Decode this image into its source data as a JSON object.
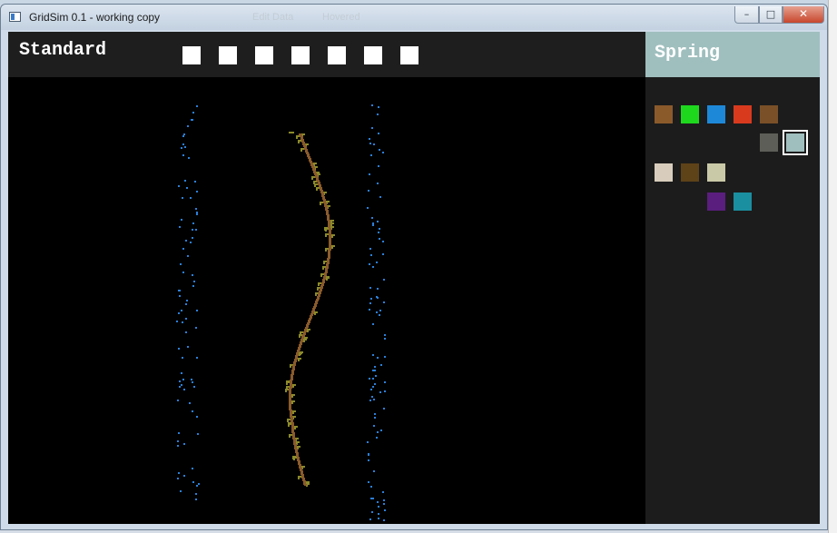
{
  "window": {
    "title": "GridSim 0.1 - working copy",
    "ghost_texts": [
      "Edit Data",
      "Hovered"
    ],
    "minimize_glyph": "–",
    "maximize_glyph": "□",
    "close_glyph": "✕"
  },
  "toolbar": {
    "mode_label": "Standard",
    "mode_buttons": 7,
    "mode_button_color": "#ffffff"
  },
  "panel": {
    "title": "Spring",
    "header_color": "#9fbfbe",
    "swatches": [
      {
        "color": "#8a5a2b",
        "selected": false
      },
      {
        "color": "#1ed81e",
        "selected": false
      },
      {
        "color": "#1e88d8",
        "selected": false
      },
      {
        "color": "#d83a1e",
        "selected": false
      },
      {
        "color": "#7a5028",
        "selected": false
      },
      {
        "color": "#5e5e58",
        "selected": false
      },
      {
        "color": "#9fbfbe",
        "selected": true
      },
      {
        "color": "#d8cdbc",
        "selected": false
      },
      {
        "color": "#5e4218",
        "selected": false
      },
      {
        "color": "#c9c9a8",
        "selected": false
      },
      {
        "color": "#5a1e7e",
        "selected": false
      },
      {
        "color": "#1a8fa0",
        "selected": false
      }
    ]
  },
  "simulation": {
    "background": "#000000",
    "water_color": "#2a7fd8",
    "vine_stem_color": "#8a5a2b",
    "vine_leaf_color": "#8a8a2a"
  }
}
